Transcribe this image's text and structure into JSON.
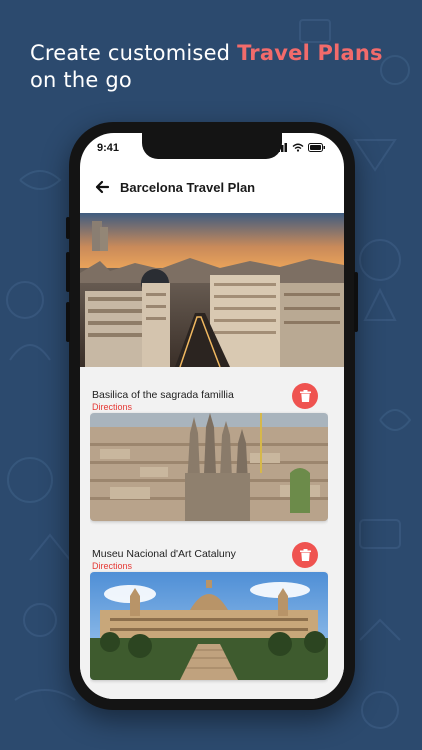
{
  "headline": {
    "line1_prefix": "Create customised ",
    "line1_accent": "Travel Plans",
    "line2": "on the go"
  },
  "status_bar": {
    "time": "9:41"
  },
  "app_header": {
    "title": "Barcelona Travel Plan"
  },
  "places": [
    {
      "name": "Basilica of the sagrada famillia",
      "link": "Directions"
    },
    {
      "name": "Museu Nacional d'Art Cataluny",
      "link": "Directions"
    }
  ],
  "colors": {
    "background": "#2c4a6e",
    "accent": "#f26b6b",
    "delete": "#ef5350",
    "link": "#e53935"
  },
  "icons": {
    "back": "arrow-left-icon",
    "delete": "trash-icon",
    "signal": "signal-icon",
    "wifi": "wifi-icon",
    "battery": "battery-icon"
  }
}
